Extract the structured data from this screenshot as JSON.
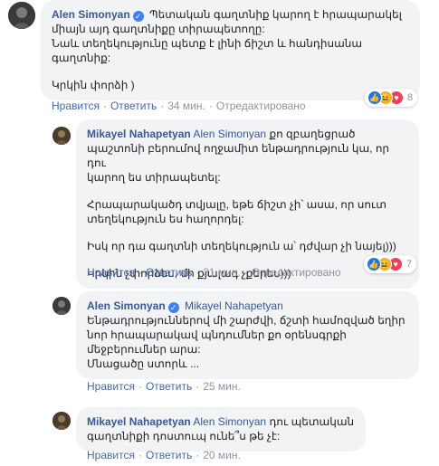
{
  "comments": [
    {
      "author": "Alen Simonyan",
      "verified": true,
      "lines": [
        "Պետական գաղտնիք կարող է հրապարակել",
        "միայն այդ գաղտնիքը տիրապետողը:",
        "Նաև տեղեկությունը պետք է լինի ճիշտ և հանդիսանա",
        "գաղտնիք:",
        "",
        "Կրկին փորձի )"
      ],
      "like_label": "Нравится",
      "reply_label": "Ответить",
      "time": "34 мин.",
      "edited_label": "Отредактировано",
      "reaction_count": "8"
    },
    {
      "author": "Mikayel Nahapetyan",
      "mention": "Alen Simonyan",
      "lines_first": "քո զբաղեցրած",
      "lines": [
        "պաշտոնի բերումով ողջամիտ ենթադրություն կա, որ դու",
        "կարող ես տիրապետել:",
        "",
        "Հրապարակածդ տվյալը, եթե ճիշտ չի՝ ասա, որ սուտ",
        "տեղեկություն ես հաղորդել:",
        "",
        "Իսկ որ դա գաղտնի տեղեկություն ա՝ դժվար չի նայել)))",
        "",
        "Կրկին չփորձես, մի քյալագ չքերես)))"
      ],
      "like_label": "Нравится",
      "reply_label": "Ответить",
      "time": "31 мин.",
      "edited_label": "Отредактировано",
      "reaction_count": "7"
    },
    {
      "author": "Alen Simonyan",
      "verified": true,
      "mention": "Mikayel Nahapetyan",
      "lines": [
        "Ենթադրություններով մի շարժվի, ճշտի համոզված եղիր",
        "նոր հրապարակավ պնդումներ քո օրենսգրքի",
        "մեջբերումներ արա:",
        "Մնացածը ստորև ..."
      ],
      "like_label": "Нравится",
      "reply_label": "Ответить",
      "time": "25 мин."
    },
    {
      "author": "Mikayel Nahapetyan",
      "mention": "Alen Simonyan",
      "lines_first": "դու պետական",
      "lines": [
        "գաղտնիքի դոստուպ ունե՞ս թե չէ:"
      ],
      "like_label": "Нравится",
      "reply_label": "Ответить",
      "time": "20 мин."
    }
  ],
  "colors": {
    "link": "#385898",
    "action": "#4267b2",
    "muted": "#90949c",
    "bubble": "#f2f3f5",
    "like": "#1877f2",
    "haha": "#f7b125",
    "love": "#f33e58"
  },
  "icons": [
    "verified-badge-icon",
    "like-reaction-icon",
    "haha-reaction-icon",
    "love-reaction-icon"
  ]
}
